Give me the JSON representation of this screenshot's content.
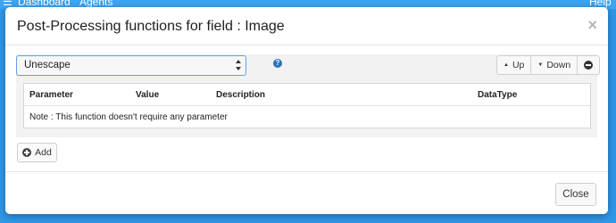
{
  "background_nav": {
    "items": [
      "Dashboard",
      "Agents",
      "Help C"
    ]
  },
  "modal": {
    "title": "Post-Processing functions for field : Image",
    "close_symbol": "×"
  },
  "function_select": {
    "selected": "Unescape"
  },
  "help_icon": {
    "symbol": "?"
  },
  "order_buttons": {
    "up_label": "Up",
    "down_label": "Down"
  },
  "params_table": {
    "columns": [
      "Parameter",
      "Value",
      "Description",
      "DataType"
    ],
    "note": "Note : This function doesn't require any parameter"
  },
  "add_button": {
    "label": "Add"
  },
  "footer": {
    "close_label": "Close"
  },
  "colors": {
    "page_background": "#2f97e8",
    "select_border": "#5f9fe2",
    "help_icon": "#2b73b8"
  },
  "icons": {
    "help": "question-circle-icon",
    "up": "caret-up-icon",
    "down": "caret-down-icon",
    "remove": "minus-circle-icon",
    "add": "plus-circle-icon",
    "dismiss": "close-x-icon"
  }
}
